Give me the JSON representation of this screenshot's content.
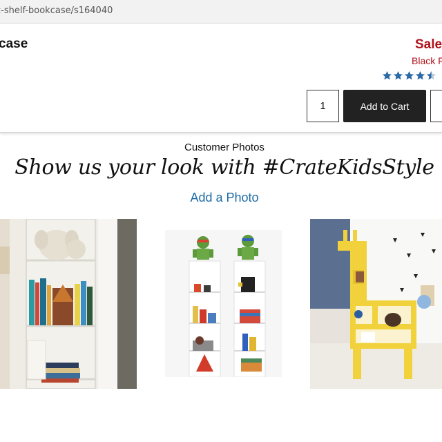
{
  "browser": {
    "url": "c-shelf-bookcase/s164040"
  },
  "product": {
    "title_fragment": "case",
    "sale_label": "Sale",
    "promo_label": "Black F",
    "rating": 4.5,
    "rating_max": 5,
    "star_color": "#2b6aa6",
    "quantity": "1",
    "add_to_cart_label": "Add to Cart"
  },
  "customer_photos": {
    "section_label": "Customer Photos",
    "tagline": "Show us your look with #CrateKidsStyle",
    "add_photo_label": "Add a Photo",
    "link_color": "#1b6aa5",
    "sale_color": "#b0121b"
  }
}
